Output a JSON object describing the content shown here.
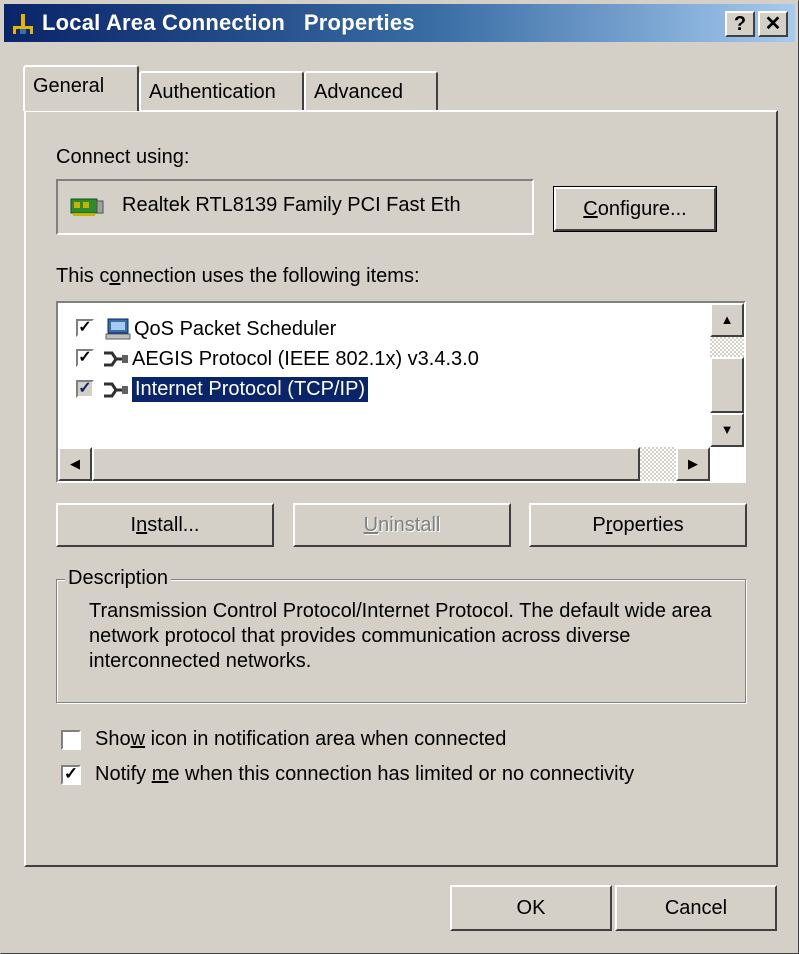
{
  "window": {
    "title": "Local Area Connection   Properties",
    "help_button": "?",
    "close_button": "✕"
  },
  "tabs": [
    {
      "label": "General"
    },
    {
      "label": "Authentication"
    },
    {
      "label": "Advanced"
    }
  ],
  "general": {
    "connect_using_label": "Connect using:",
    "adapter_name": "Realtek RTL8139 Family PCI Fast Eth",
    "configure_prefix": "C",
    "configure_rest": "onfigure...",
    "items_label_a": "This c",
    "items_label_u": "o",
    "items_label_b": "nnection uses the following items:",
    "items": [
      {
        "label": "QoS Packet Scheduler",
        "checked": true,
        "icon": "scheduler-icon"
      },
      {
        "label": "AEGIS Protocol (IEEE 802.1x) v3.4.3.0",
        "checked": true,
        "icon": "protocol-icon"
      },
      {
        "label": "Internet Protocol (TCP/IP)",
        "checked": true,
        "selected": true,
        "icon": "protocol-icon"
      }
    ],
    "install_a": "I",
    "install_u": "n",
    "install_b": "stall...",
    "uninstall_u": "U",
    "uninstall_b": "ninstall",
    "properties_a": "P",
    "properties_u": "r",
    "properties_b": "operties",
    "description_title": "Description",
    "description_text": "Transmission Control Protocol/Internet Protocol. The default wide area network protocol that provides communication across diverse interconnected networks.",
    "show_icon_a": "Sho",
    "show_icon_u": "w",
    "show_icon_b": " icon in notification area when connected",
    "show_icon_checked": false,
    "notify_a": "Notify ",
    "notify_u": "m",
    "notify_b": "e when this connection has limited or no connectivity",
    "notify_checked": true
  },
  "footer": {
    "ok": "OK",
    "cancel": "Cancel"
  },
  "colors": {
    "selection": "#0a246a",
    "face": "#d4d0c8"
  }
}
